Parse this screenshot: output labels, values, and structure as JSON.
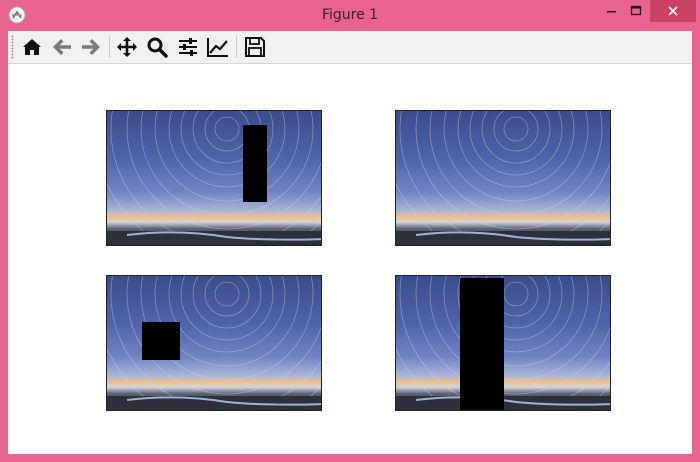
{
  "window": {
    "title": "Figure 1"
  },
  "toolbar": {
    "buttons": [
      {
        "name": "home-icon"
      },
      {
        "name": "back-arrow-icon"
      },
      {
        "name": "forward-arrow-icon"
      },
      {
        "name": "pan-icon"
      },
      {
        "name": "zoom-icon"
      },
      {
        "name": "configure-subplots-icon"
      },
      {
        "name": "edit-axes-icon"
      },
      {
        "name": "save-icon"
      }
    ]
  },
  "figure": {
    "subplots": [
      {
        "image": "star-trails-night-sky",
        "occluder": "tall-rectangle"
      },
      {
        "image": "star-trails-night-sky",
        "occluder": "none"
      },
      {
        "image": "star-trails-night-sky",
        "occluder": "square"
      },
      {
        "image": "star-trails-night-sky",
        "occluder": "tall-wide-rectangle"
      }
    ]
  },
  "colors": {
    "frame": "#e8638f",
    "close_button": "#c94262",
    "toolbar_bg": "#f0f0f0",
    "occluder": "#000000"
  }
}
